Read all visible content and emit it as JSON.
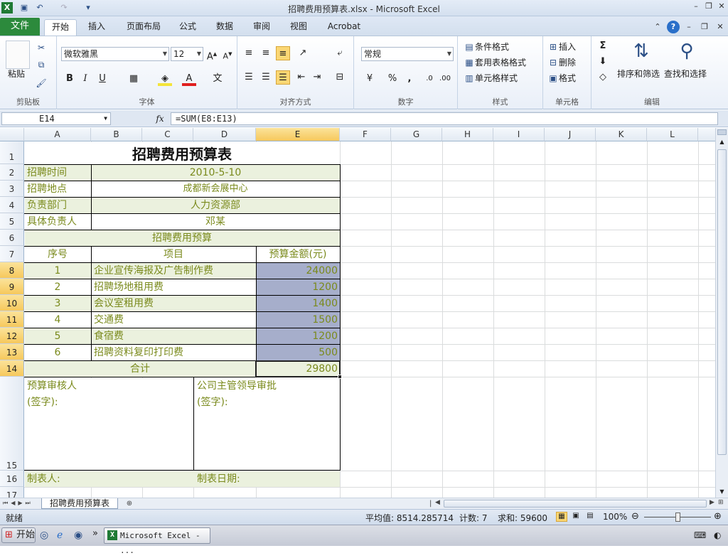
{
  "window": {
    "title": "招聘费用预算表.xlsx  -  Microsoft Excel"
  },
  "tabs": {
    "file": "文件",
    "items": [
      "开始",
      "插入",
      "页面布局",
      "公式",
      "数据",
      "审阅",
      "视图",
      "Acrobat"
    ]
  },
  "ribbon": {
    "clipboard": {
      "label": "剪贴板",
      "paste": "粘贴"
    },
    "font": {
      "label": "字体",
      "name": "微软雅黑",
      "size": "12",
      "bold": "B",
      "italic": "I",
      "underline": "U"
    },
    "alignment": {
      "label": "对齐方式"
    },
    "number": {
      "label": "数字",
      "format": "常规",
      "percent": "%",
      "comma": ","
    },
    "styles": {
      "label": "样式",
      "conditional": "条件格式",
      "table": "套用表格格式",
      "cell": "单元格样式"
    },
    "cells": {
      "label": "单元格",
      "insert": "插入",
      "delete": "删除",
      "format": "格式"
    },
    "editing": {
      "label": "编辑",
      "sum": "Σ",
      "sort": "排序和筛选",
      "find": "查找和选择"
    }
  },
  "formula_bar": {
    "name_box": "E14",
    "fx": "fx",
    "formula": "=SUM(E8:E13)"
  },
  "columns": [
    "A",
    "B",
    "C",
    "D",
    "E",
    "F",
    "G",
    "H",
    "I",
    "J",
    "K",
    "L"
  ],
  "rows": [
    "1",
    "2",
    "3",
    "4",
    "5",
    "6",
    "7",
    "8",
    "9",
    "10",
    "11",
    "12",
    "13",
    "14",
    "15",
    "16",
    "17"
  ],
  "sheet": {
    "title": "招聘费用预算表",
    "info": [
      {
        "label": "招聘时间",
        "value": "2010-5-10"
      },
      {
        "label": "招聘地点",
        "value": "成都新会展中心"
      },
      {
        "label": "负责部门",
        "value": "人力资源部"
      },
      {
        "label": "具体负责人",
        "value": "邓某"
      }
    ],
    "section": "招聘费用预算",
    "headers": {
      "no": "序号",
      "item": "项目",
      "amount": "预算金额(元)"
    },
    "items": [
      {
        "no": "1",
        "item": "企业宣传海报及广告制作费",
        "amount": "24000"
      },
      {
        "no": "2",
        "item": "招聘场地租用费",
        "amount": "1200"
      },
      {
        "no": "3",
        "item": "会议室租用费",
        "amount": "1400"
      },
      {
        "no": "4",
        "item": "交通费",
        "amount": "1500"
      },
      {
        "no": "5",
        "item": "食宿费",
        "amount": "1200"
      },
      {
        "no": "6",
        "item": "招聘资料复印打印费",
        "amount": "500"
      }
    ],
    "total_label": "合计",
    "total_value": "29800",
    "reviewer": "预算审核人",
    "reviewer_sign": "(签字):",
    "approver": "公司主管领导审批",
    "approver_sign": "(签字):",
    "maker": "制表人:",
    "date": "制表日期:"
  },
  "sheet_tab": "招聘费用预算表",
  "status": {
    "mode": "就绪",
    "average": "平均值: 8514.285714",
    "count": "计数: 7",
    "sum": "求和: 59600",
    "zoom": "100%"
  },
  "taskbar": {
    "start": "开始",
    "app": "Microsoft Excel - ..."
  },
  "colors": {
    "text_olive": "#7a8a1c",
    "fill_green": "#ebf1de",
    "fill_select": "#a6aecb",
    "file_tab": "#2c8a3c"
  }
}
